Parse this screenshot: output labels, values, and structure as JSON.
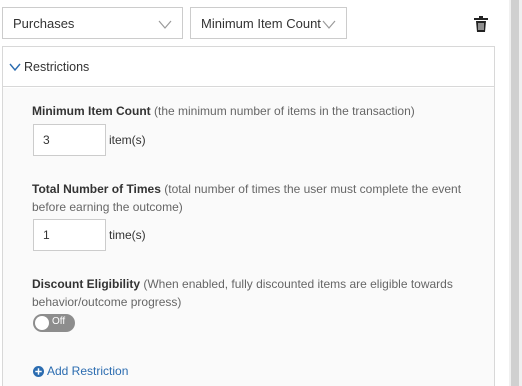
{
  "selects": {
    "category": "Purchases",
    "type": "Minimum Item Count"
  },
  "icons": {
    "delete": "trash-icon",
    "collapse": "chevron-down-icon",
    "add": "plus-circle-icon"
  },
  "restrictions": {
    "header": "Restrictions",
    "min_item_count": {
      "label": "Minimum Item Count",
      "description": " (the minimum number of items in the transaction)",
      "value": "3",
      "unit": "item(s)"
    },
    "total_times": {
      "label": "Total Number of Times",
      "description": " (total number of times the user must complete the event before earning the outcome)",
      "value": "1",
      "unit": "time(s)"
    },
    "discount": {
      "label": "Discount Eligibility",
      "description": " (When enabled, fully discounted items are eligible towards behavior/outcome progress)",
      "toggle_text": "Off",
      "enabled": false
    },
    "add_label": "Add Restriction"
  },
  "colors": {
    "link": "#2b6cb0",
    "toggle_off": "#8d8d8d",
    "border": "#cccccc"
  }
}
